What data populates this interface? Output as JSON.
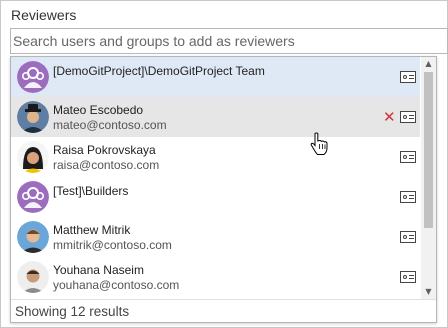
{
  "panel": {
    "title": "Reviewers",
    "search_placeholder": "Search users and groups to add as reviewers"
  },
  "results": [
    {
      "name": "[DemoGitProject]\\DemoGitProject Team",
      "email": "",
      "avatar": "group-avatar-icon",
      "state": "selected"
    },
    {
      "name": "Mateo Escobedo",
      "email": "mateo@contoso.com",
      "avatar": "user-avatar-hat",
      "state": "hover",
      "remove_glyph": "✕"
    },
    {
      "name": "Raisa Pokrovskaya",
      "email": "raisa@contoso.com",
      "avatar": "user-avatar-woman",
      "state": "normal"
    },
    {
      "name": "[Test]\\Builders",
      "email": "",
      "avatar": "group-avatar-icon",
      "state": "normal"
    },
    {
      "name": "Matthew Mitrik",
      "email": "mmitrik@contoso.com",
      "avatar": "user-avatar-man",
      "state": "normal"
    },
    {
      "name": "Youhana Naseim",
      "email": "youhana@contoso.com",
      "avatar": "user-avatar-man-2",
      "state": "normal"
    }
  ],
  "footer": {
    "status": "Showing 12 results"
  },
  "colors": {
    "selected_row": "#dfe8f5",
    "hover_row": "#e6e6e6",
    "remove": "#d13438",
    "group_avatar": "#9c6dbf"
  }
}
